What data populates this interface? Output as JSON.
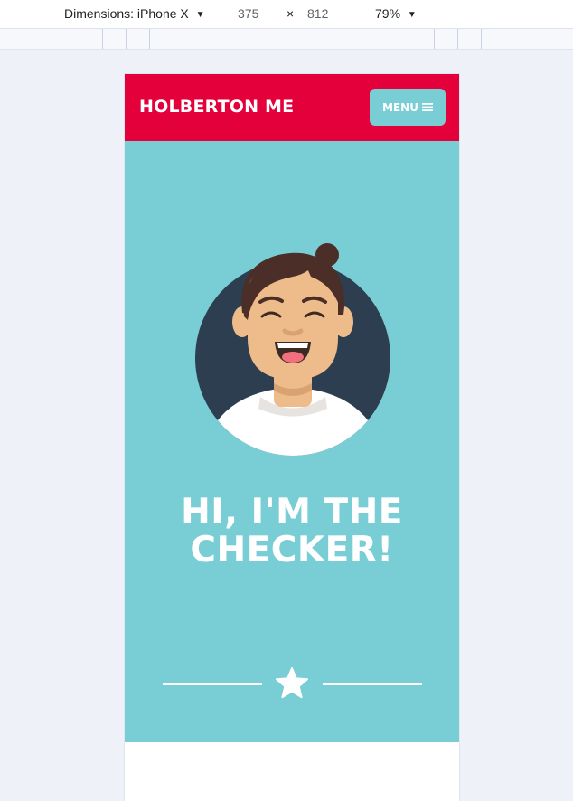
{
  "devtools": {
    "device_label": "Dimensions: iPhone X",
    "width_value": "375",
    "dimension_separator": "×",
    "height_value": "812",
    "zoom_label": "79%",
    "caret_glyph": "▼"
  },
  "site": {
    "brand": "HOLBERTON ME",
    "menu_label": "MENU",
    "menu_icon": "hamburger-icon"
  },
  "hero": {
    "headline_line1": "HI, I'M THE",
    "headline_line2": "CHECKER!",
    "avatar": "avatar-illustration",
    "divider_icon": "star-icon"
  },
  "colors": {
    "header_red": "#e4003a",
    "hero_teal": "#79cdd4",
    "avatar_bg": "#2d3e50",
    "skin": "#eebb8a",
    "hair": "#4a2e27"
  }
}
